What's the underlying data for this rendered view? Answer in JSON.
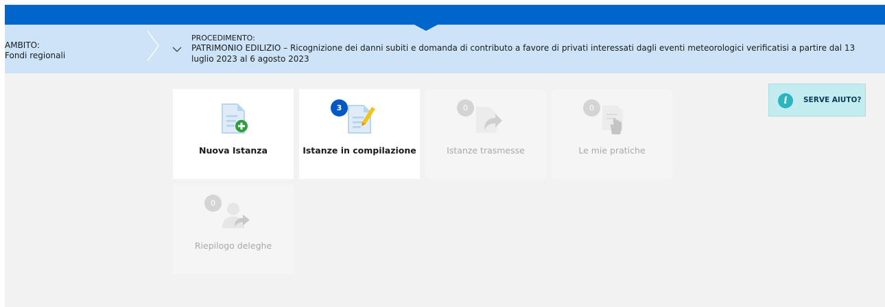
{
  "header": {
    "ambito_label": "AMBITO:",
    "ambito_value": "Fondi regionali",
    "procedimento_label": "PROCEDIMENTO:",
    "procedimento_value": "PATRIMONIO EDILIZIO – Ricognizione dei danni subiti e domanda di contributo a favore di privati interessati dagli eventi meteorologici verificatisi a partire dal 13 luglio 2023 al 6 agosto 2023"
  },
  "tiles": [
    {
      "label": "Nuova Istanza",
      "icon": "new-document-icon",
      "enabled": true
    },
    {
      "label": "Istanze in compilazione",
      "badge": "3",
      "icon": "edit-document-icon",
      "enabled": true
    },
    {
      "label": "Istanze trasmesse",
      "badge": "0",
      "icon": "sent-document-icon",
      "enabled": false
    },
    {
      "label": "Le mie pratiche",
      "badge": "0",
      "icon": "hand-document-icon",
      "enabled": false
    },
    {
      "label": "Riepilogo deleghe",
      "badge": "0",
      "icon": "delegation-icon",
      "enabled": false
    }
  ],
  "help": {
    "label": "SERVE AIUTO?",
    "icon": "info-icon"
  },
  "colors": {
    "topbar": "#0066cc",
    "crumbbar": "#cce3f8",
    "badge_active": "#0058c4",
    "icon_blue": "#b9d5ee",
    "icon_green": "#2e9e3e",
    "icon_yellow": "#f2c318",
    "help_bg": "#c2ecef",
    "help_icon": "#2cb5bf"
  }
}
